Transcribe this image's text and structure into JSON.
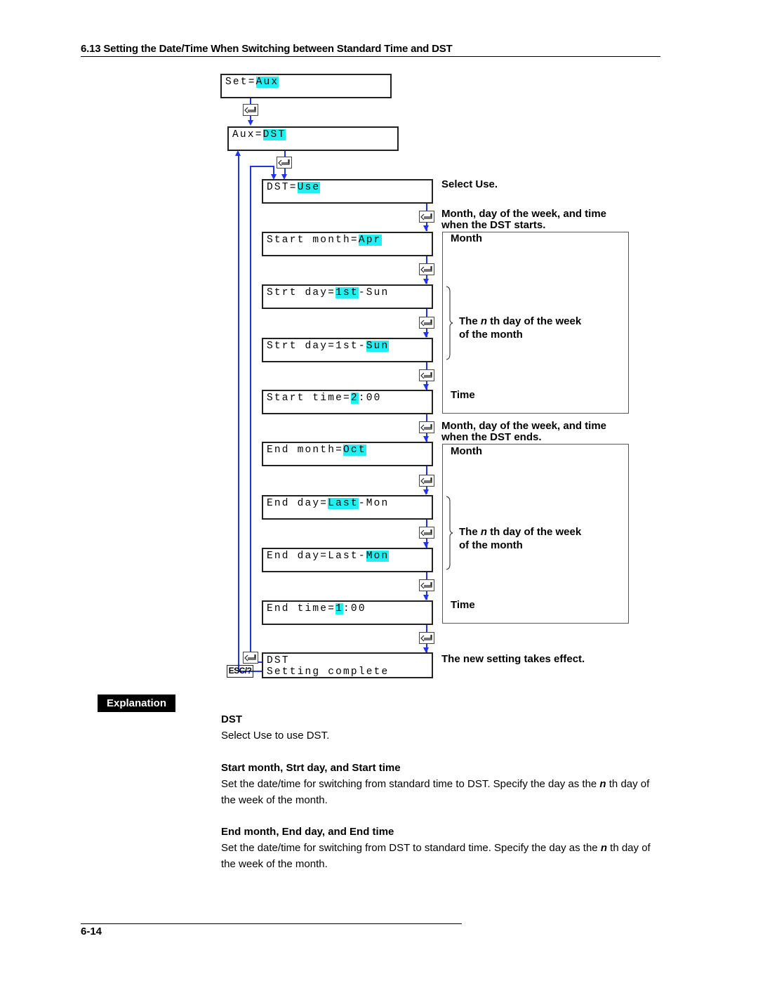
{
  "heading": "6.13  Setting the Date/Time When Switching between Standard Time and DST",
  "flow": {
    "set_aux": {
      "pre": "Set=",
      "hl": "Aux",
      "post": ""
    },
    "aux_dst": {
      "pre": "Aux=",
      "hl": "DST",
      "post": ""
    },
    "dst_use": {
      "pre": "DST=",
      "hl": "Use",
      "post": ""
    },
    "start_month": {
      "pre": "Start month=",
      "hl": "Apr",
      "post": ""
    },
    "strt_day_nth": {
      "pre": "Strt day=",
      "hl": "1st",
      "post": "-Sun"
    },
    "strt_day_dow": {
      "pre": "Strt day=1st-",
      "hl": "Sun",
      "post": ""
    },
    "start_time": {
      "pre": "Start time=",
      "hl": "2",
      "post": ":00"
    },
    "end_month": {
      "pre": "End month=",
      "hl": "Oct",
      "post": ""
    },
    "end_day_nth": {
      "pre": "End day=",
      "hl": "Last",
      "post": "-Mon"
    },
    "end_day_dow": {
      "pre": "End day=Last-",
      "hl": "Mon",
      "post": ""
    },
    "end_time": {
      "pre": "End time=",
      "hl": "1",
      "post": ":00"
    },
    "complete": {
      "line1": "DST",
      "line2": "Setting complete"
    },
    "esc_key": "ESC/?",
    "enter_icon": "enter-key-icon"
  },
  "notes": {
    "select_use": "Select Use.",
    "start_title_1": "Month, day of the week, and time",
    "start_title_2": "when the DST starts.",
    "end_title_1": "Month, day of the week, and time",
    "end_title_2": "when the DST ends.",
    "month": "Month",
    "nth_1a": "The ",
    "nth_1n": "n",
    "nth_1b": " th day of the week",
    "nth_2": "of the month",
    "time": "Time",
    "takes_effect": "The new setting takes effect."
  },
  "explanation": {
    "tag": "Explanation",
    "sections": [
      {
        "title": "DST",
        "text": "Select Use to use DST."
      },
      {
        "title": "Start month, Strt day, and Start time",
        "text_a": "Set the date/time for switching from standard time to DST. Specify the day as the ",
        "text_n": "n",
        "text_b": " th day of the week of the month."
      },
      {
        "title": "End month, End day, and End time",
        "text_a": "Set the date/time for switching from DST to standard time. Specify the day as the ",
        "text_n": "n",
        "text_b": " th day of the week of the month."
      }
    ]
  },
  "footer": {
    "page": "6-14"
  }
}
